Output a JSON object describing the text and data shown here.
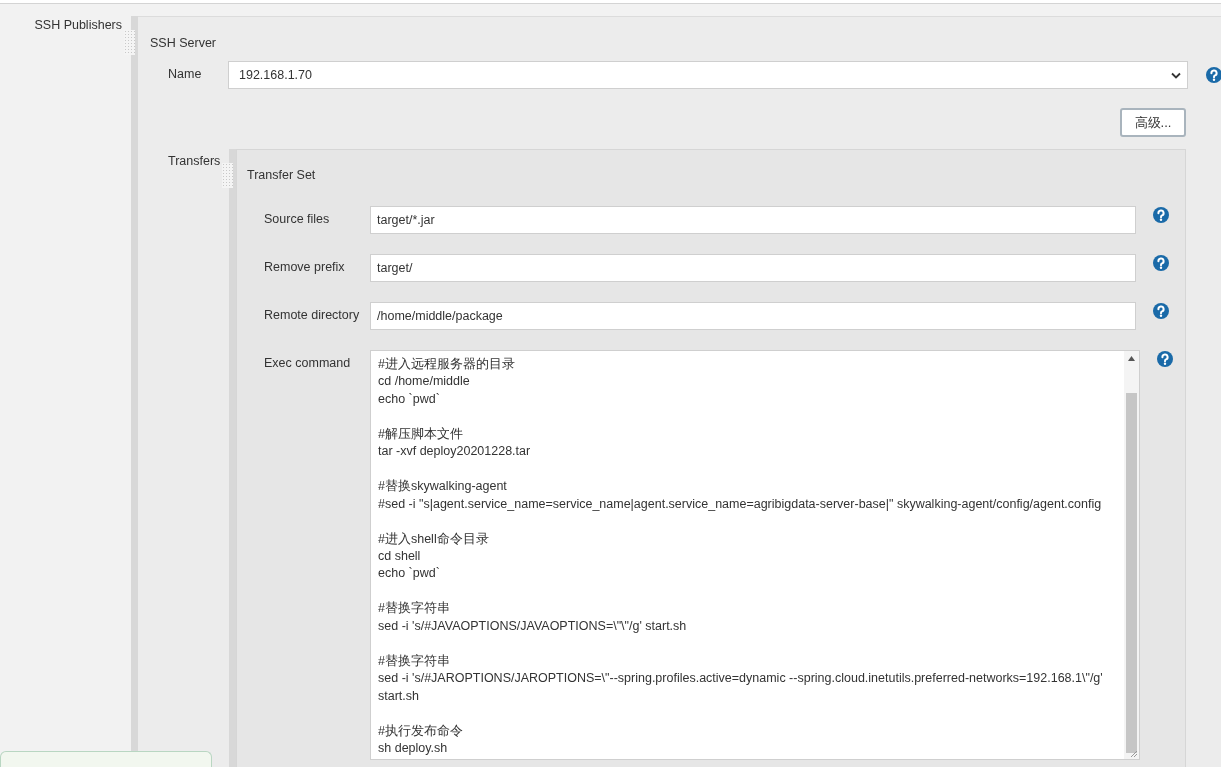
{
  "section_label": "SSH Publishers",
  "server": {
    "title": "SSH Server",
    "name_label": "Name",
    "name_value": "192.168.1.70",
    "advanced_button": "高级...",
    "transfers_label": "Transfers",
    "transfer_set": {
      "title": "Transfer Set",
      "fields": [
        {
          "label": "Source files",
          "value": "target/*.jar"
        },
        {
          "label": "Remove prefix",
          "value": "target/"
        },
        {
          "label": "Remote directory",
          "value": "/home/middle/package"
        }
      ],
      "exec_command": {
        "label": "Exec command",
        "value": "#进入远程服务器的目录\ncd /home/middle\necho `pwd`\n\n#解压脚本文件\ntar -xvf deploy20201228.tar\n\n#替换skywalking-agent\n#sed -i \"s|agent.service_name=service_name|agent.service_name=agribigdata-server-base|\" skywalking-agent/config/agent.config\n\n#进入shell命令目录\ncd shell\necho `pwd`\n\n#替换字符串\nsed -i 's/#JAVAOPTIONS/JAVAOPTIONS=\\\"\\\"/g' start.sh\n\n#替换字符串\nsed -i 's/#JAROPTIONS/JAROPTIONS=\\\"--spring.profiles.active=dynamic --spring.cloud.inetutils.preferred-networks=192.168.1\\\"/g' start.sh\n\n#执行发布命令\nsh deploy.sh"
      }
    }
  }
}
